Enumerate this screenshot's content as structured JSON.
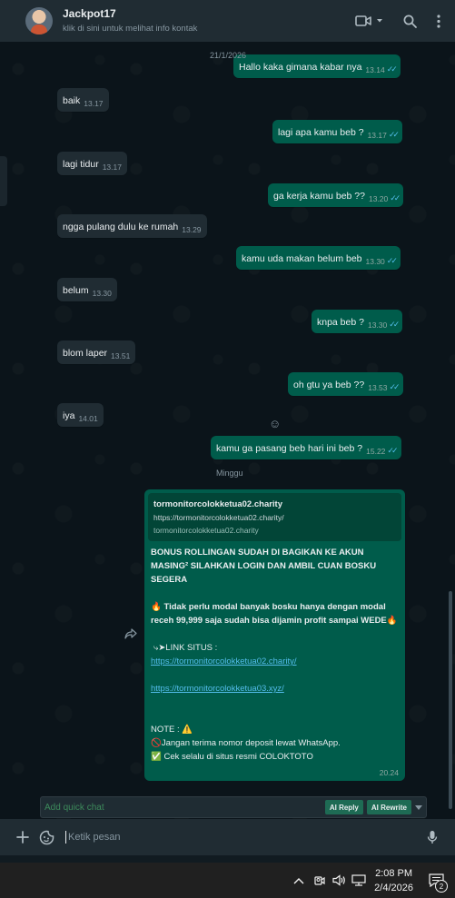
{
  "header": {
    "contact_name": "Jackpot17",
    "subtitle": "klik di sini untuk melihat info kontak",
    "icons": [
      "video-call-icon",
      "chevron-down-icon",
      "search-icon",
      "menu-icon"
    ]
  },
  "chat": {
    "date_first": "21/1/2026",
    "date_second": "Minggu",
    "messages": [
      {
        "dir": "out",
        "text": "Hallo kaka gimana kabar nya",
        "time": "13.14"
      },
      {
        "dir": "in",
        "text": "baik",
        "time": "13.17"
      },
      {
        "dir": "out",
        "text": "lagi apa kamu beb ?",
        "time": "13.17"
      },
      {
        "dir": "in",
        "text": "lagi tidur",
        "time": "13.17"
      },
      {
        "dir": "out",
        "text": "ga kerja kamu beb ??",
        "time": "13.20"
      },
      {
        "dir": "in",
        "text": "ngga pulang dulu ke rumah",
        "time": "13.29"
      },
      {
        "dir": "out",
        "text": "kamu uda makan belum beb",
        "time": "13.30"
      },
      {
        "dir": "in",
        "text": "belum",
        "time": "13.30"
      },
      {
        "dir": "out",
        "text": "knpa beb ?",
        "time": "13.30"
      },
      {
        "dir": "in",
        "text": "blom laper",
        "time": "13.51"
      },
      {
        "dir": "out",
        "text": "oh gtu ya beb ??",
        "time": "13.53"
      },
      {
        "dir": "in",
        "text": "iya",
        "time": "14.01"
      },
      {
        "dir": "out",
        "text": "kamu ga pasang beb hari ini beb ?",
        "time": "15.22"
      }
    ],
    "link_message": {
      "preview_title": "tormonitorcolokketua02.charity",
      "preview_url": "https://tormonitorcolokketua02.charity/",
      "preview_host": "tormonitorcolokketua02.charity",
      "headline": "BONUS ROLLINGAN SUDAH DI BAGIKAN KE AKUN MASING² SILAHKAN LOGIN DAN AMBIL CUAN BOSKU SEGERA",
      "promo": "🔥 Tidak perlu modal banyak bosku hanya dengan modal receh 99,999 saja sudah bisa dijamin profit sampai WEDE🔥",
      "link_label": "⤷➤LINK SITUS :",
      "link1": "https://tormonitorcolokketua02.charity/",
      "link2": "https://tormonitorcolokketua03.xyz/",
      "note_label": "NOTE :  ⚠️",
      "note1": "🚫Jangan terima nomor deposit lewat WhatsApp.",
      "note2": "✅ Cek selalu di situs resmi COLOKTOTO",
      "time": "20.24"
    }
  },
  "quick_chat": {
    "placeholder": "Add quick chat",
    "ai_reply": "AI Reply",
    "ai_rewrite": "AI Rewrite"
  },
  "composer": {
    "placeholder": "Ketik pesan",
    "icons": [
      "plus-icon",
      "sticker-icon",
      "microphone-icon"
    ]
  },
  "taskbar": {
    "time": "2:08 PM",
    "date": "2/4/2026",
    "notification_count": "2"
  }
}
